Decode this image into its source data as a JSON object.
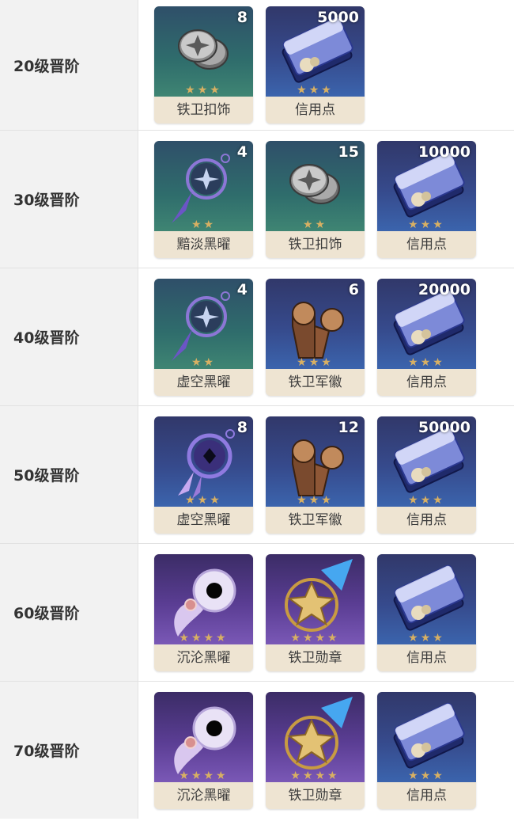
{
  "rows": [
    {
      "label": "20级晋阶",
      "items": [
        {
          "name": "铁卫扣饰",
          "qty": "8",
          "bg": "teal",
          "icon": "coin-icon",
          "stars": "★★★"
        },
        {
          "name": "信用点",
          "qty": "5000",
          "bg": "blue",
          "icon": "credit-icon",
          "stars": "★★★"
        }
      ]
    },
    {
      "label": "30级晋阶",
      "items": [
        {
          "name": "黯淡黑曜",
          "qty": "4",
          "bg": "teal",
          "icon": "obsidian-charm-icon",
          "stars": "★★"
        },
        {
          "name": "铁卫扣饰",
          "qty": "15",
          "bg": "teal",
          "icon": "coin-icon",
          "stars": "★★"
        },
        {
          "name": "信用点",
          "qty": "10000",
          "bg": "blue",
          "icon": "credit-icon",
          "stars": "★★★"
        }
      ]
    },
    {
      "label": "40级晋阶",
      "items": [
        {
          "name": "虚空黑曜",
          "qty": "4",
          "bg": "teal",
          "icon": "obsidian-charm-icon",
          "stars": "★★"
        },
        {
          "name": "铁卫军徽",
          "qty": "6",
          "bg": "blue",
          "icon": "badge-icon",
          "stars": "★★★"
        },
        {
          "name": "信用点",
          "qty": "20000",
          "bg": "blue",
          "icon": "credit-icon",
          "stars": "★★★"
        }
      ]
    },
    {
      "label": "50级晋阶",
      "items": [
        {
          "name": "虚空黑曜",
          "qty": "8",
          "bg": "blue",
          "icon": "void-obsidian-icon",
          "stars": "★★★"
        },
        {
          "name": "铁卫军徽",
          "qty": "12",
          "bg": "blue",
          "icon": "badge-icon",
          "stars": "★★★"
        },
        {
          "name": "信用点",
          "qty": "50000",
          "bg": "blue",
          "icon": "credit-icon",
          "stars": "★★★"
        }
      ]
    },
    {
      "label": "60级晋阶",
      "items": [
        {
          "name": "沉沦黑曜",
          "qty": "",
          "bg": "purple",
          "icon": "chaos-obsidian-icon",
          "stars": "★★★★"
        },
        {
          "name": "铁卫勋章",
          "qty": "",
          "bg": "purple",
          "icon": "medal-icon",
          "stars": "★★★★"
        },
        {
          "name": "信用点",
          "qty": "",
          "bg": "blue",
          "icon": "credit-icon",
          "stars": "★★★"
        }
      ]
    },
    {
      "label": "70级晋阶",
      "items": [
        {
          "name": "沉沦黑曜",
          "qty": "",
          "bg": "purple",
          "icon": "chaos-obsidian-icon",
          "stars": "★★★★"
        },
        {
          "name": "铁卫勋章",
          "qty": "",
          "bg": "purple",
          "icon": "medal-icon",
          "stars": "★★★★"
        },
        {
          "name": "信用点",
          "qty": "",
          "bg": "blue",
          "icon": "credit-icon",
          "stars": "★★★"
        }
      ]
    }
  ]
}
